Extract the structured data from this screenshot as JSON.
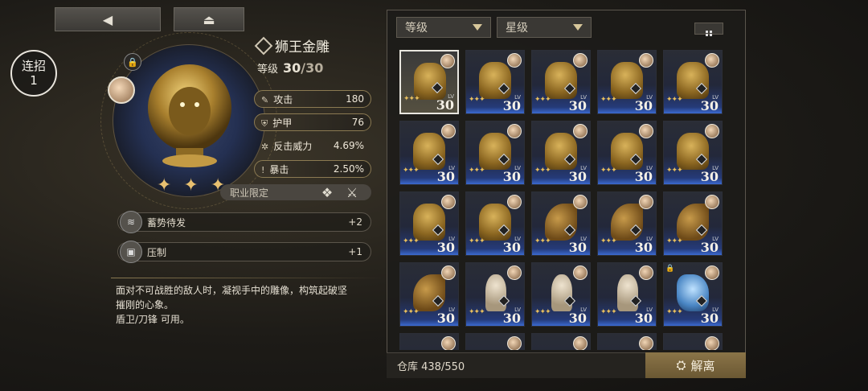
{
  "nav": {
    "back_icon": "back-arrow-icon",
    "home_icon": "home-icon"
  },
  "combo": {
    "label": "连招",
    "value": "1"
  },
  "item": {
    "name": "狮王金雕",
    "level_label": "等级",
    "level": "30",
    "level_max": "/30",
    "stars": "✦ ✦ ✦",
    "stats": [
      {
        "label": "攻击",
        "value": "180",
        "icon": "sword-icon"
      },
      {
        "label": "护甲",
        "value": "76",
        "icon": "shield-icon"
      },
      {
        "label": "反击威力",
        "value": "4.69%",
        "icon": "counter-icon"
      },
      {
        "label": "暴击",
        "value": "2.50%",
        "icon": "crit-icon"
      }
    ],
    "job_limit": "职业限定",
    "skills": [
      {
        "name": "蓄势待发",
        "value": "+2"
      },
      {
        "name": "压制",
        "value": "+1"
      }
    ],
    "description_lines": [
      "面对不可战胜的敌人时，凝视手中的雕像，构筑起破坚",
      "摧刚的心象。",
      "盾卫/刀锋 可用。"
    ]
  },
  "inventory": {
    "filter_level": "等级",
    "filter_star": "星级",
    "storage": "仓库 438/550",
    "dismantle": "解离",
    "level_tag": "LV",
    "items": [
      {
        "fig": "lion",
        "lv": "30",
        "selected": true
      },
      {
        "fig": "lion",
        "lv": "30"
      },
      {
        "fig": "lion",
        "lv": "30"
      },
      {
        "fig": "lion2",
        "lv": "30"
      },
      {
        "fig": "lion2",
        "lv": "30"
      },
      {
        "fig": "lion2",
        "lv": "30"
      },
      {
        "fig": "lion2",
        "lv": "30"
      },
      {
        "fig": "lion2",
        "lv": "30"
      },
      {
        "fig": "lion2",
        "lv": "30"
      },
      {
        "fig": "lion2",
        "lv": "30"
      },
      {
        "fig": "lion2",
        "lv": "30"
      },
      {
        "fig": "lion2",
        "lv": "30"
      },
      {
        "fig": "wing",
        "lv": "30"
      },
      {
        "fig": "wing",
        "lv": "30"
      },
      {
        "fig": "wing",
        "lv": "30"
      },
      {
        "fig": "wing",
        "lv": "30"
      },
      {
        "fig": "maiden",
        "lv": "30"
      },
      {
        "fig": "maiden",
        "lv": "30"
      },
      {
        "fig": "maiden",
        "lv": "30"
      },
      {
        "fig": "crystal",
        "lv": "30",
        "locked": true
      }
    ]
  }
}
